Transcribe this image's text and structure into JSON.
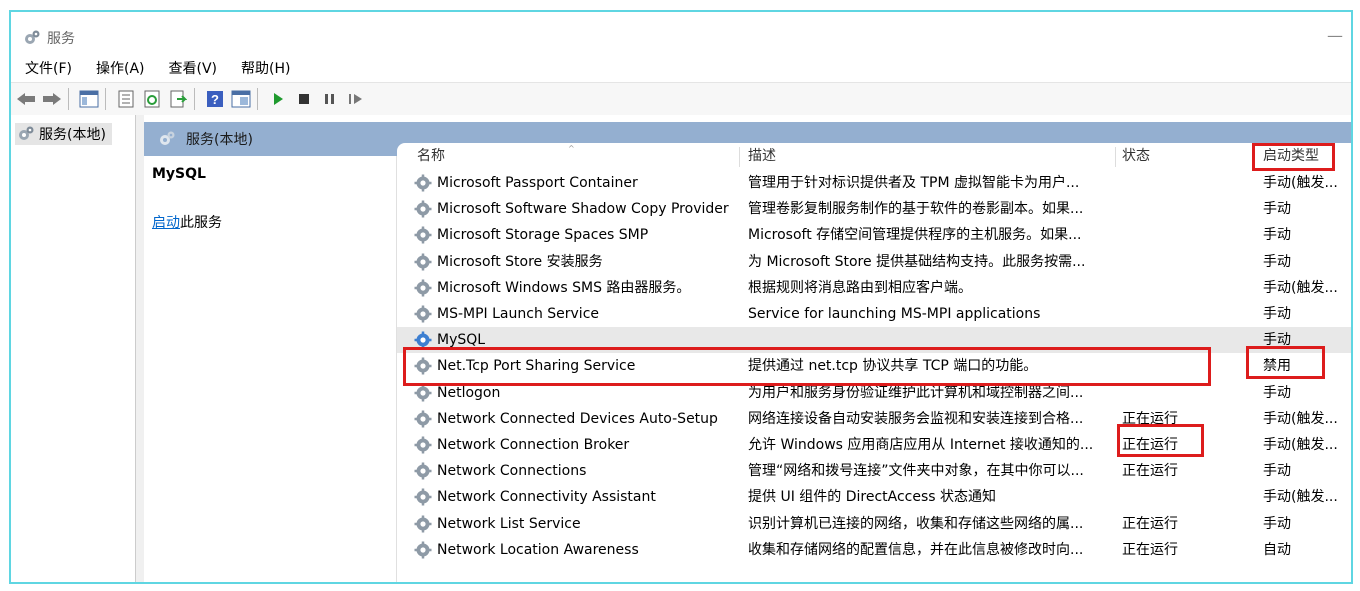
{
  "window": {
    "title": "服务"
  },
  "menu": [
    "文件(F)",
    "操作(A)",
    "查看(V)",
    "帮助(H)"
  ],
  "toolbar": {
    "buttons": [
      "back-icon",
      "forward-icon",
      "show-hide-tree-icon",
      "properties-icon",
      "refresh-icon",
      "export-list-icon",
      "help-icon",
      "console-icon",
      "start-service-icon",
      "stop-service-icon",
      "pause-service-icon",
      "resume-service-icon"
    ]
  },
  "tree": {
    "root_label": "服务(本地)"
  },
  "pane": {
    "header_title": "服务(本地)"
  },
  "detail": {
    "service_name": "MySQL",
    "action_link": "启动",
    "action_suffix": "此服务"
  },
  "table": {
    "headers": {
      "name": "名称",
      "description": "描述",
      "status": "状态",
      "startup": "启动类型"
    },
    "rows": [
      {
        "name": "Microsoft Passport Container",
        "description": "管理用于针对标识提供者及 TPM 虚拟智能卡为用户...",
        "status": "",
        "startup": "手动(触发..."
      },
      {
        "name": "Microsoft Software Shadow Copy Provider",
        "description": "管理卷影复制服务制作的基于软件的卷影副本。如果...",
        "status": "",
        "startup": "手动"
      },
      {
        "name": "Microsoft Storage Spaces SMP",
        "description": "Microsoft 存储空间管理提供程序的主机服务。如果...",
        "status": "",
        "startup": "手动"
      },
      {
        "name": "Microsoft Store 安装服务",
        "description": "为 Microsoft Store 提供基础结构支持。此服务按需...",
        "status": "",
        "startup": "手动"
      },
      {
        "name": "Microsoft Windows SMS 路由器服务。",
        "description": "根据规则将消息路由到相应客户端。",
        "status": "",
        "startup": "手动(触发..."
      },
      {
        "name": "MS-MPI Launch Service",
        "description": "Service for launching MS-MPI applications",
        "status": "",
        "startup": "手动"
      },
      {
        "name": "MySQL",
        "description": "",
        "status": "",
        "startup": "手动"
      },
      {
        "name": "Net.Tcp Port Sharing Service",
        "description": "提供通过 net.tcp 协议共享 TCP 端口的功能。",
        "status": "",
        "startup": "禁用"
      },
      {
        "name": "Netlogon",
        "description": "为用户和服务身份验证维护此计算机和域控制器之间...",
        "status": "",
        "startup": "手动"
      },
      {
        "name": "Network Connected Devices Auto-Setup",
        "description": "网络连接设备自动安装服务会监视和安装连接到合格...",
        "status": "正在运行",
        "startup": "手动(触发..."
      },
      {
        "name": "Network Connection Broker",
        "description": "允许 Windows 应用商店应用从 Internet 接收通知的...",
        "status": "正在运行",
        "startup": "手动(触发..."
      },
      {
        "name": "Network Connections",
        "description": "管理“网络和拨号连接”文件夹中对象，在其中你可以...",
        "status": "正在运行",
        "startup": "手动"
      },
      {
        "name": "Network Connectivity Assistant",
        "description": "提供 UI 组件的 DirectAccess 状态通知",
        "status": "",
        "startup": "手动(触发..."
      },
      {
        "name": "Network List Service",
        "description": "识别计算机已连接的网络，收集和存储这些网络的属...",
        "status": "正在运行",
        "startup": "手动"
      },
      {
        "name": "Network Location Awareness",
        "description": "收集和存储网络的配置信息，并在此信息被修改时向...",
        "status": "正在运行",
        "startup": "自动"
      }
    ]
  },
  "colors": {
    "highlight": "#dd1c1c",
    "pane_header": "#94afd0",
    "link": "#0066cc",
    "window_border": "#5fd6e2"
  }
}
